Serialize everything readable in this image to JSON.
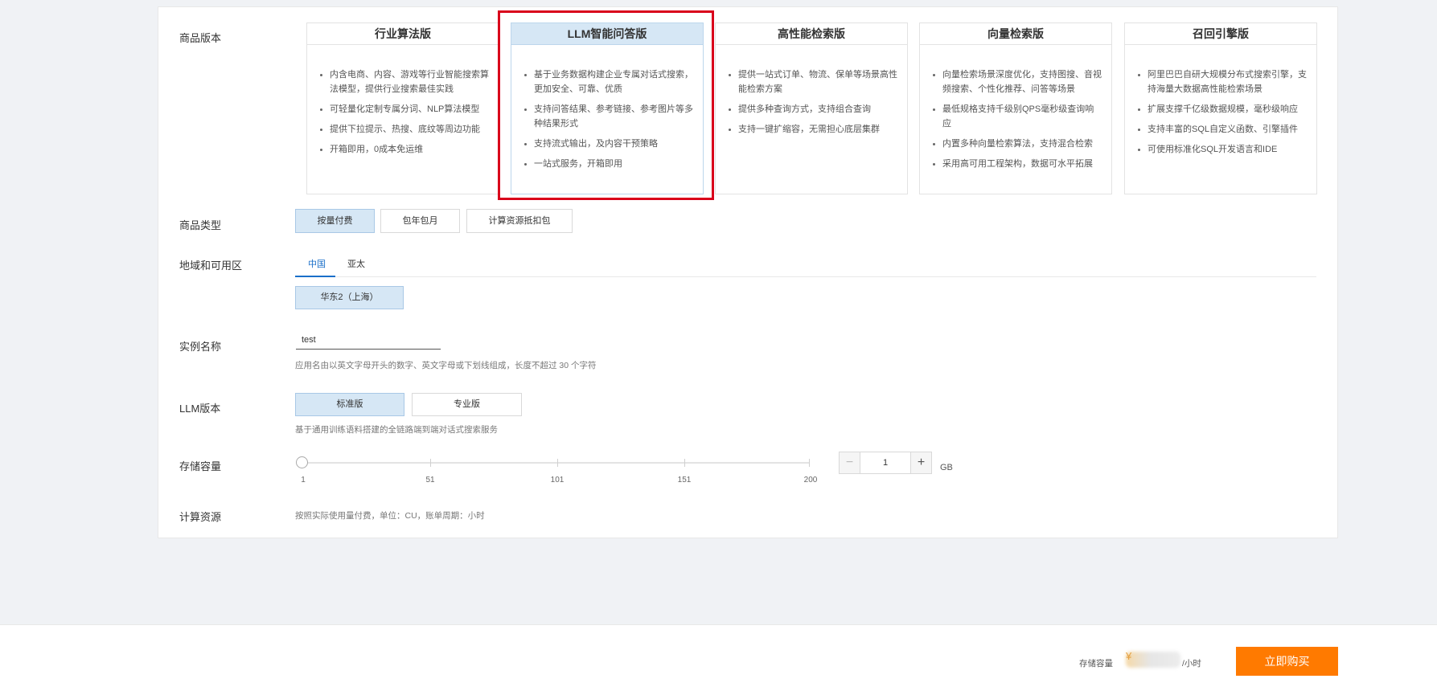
{
  "form": {
    "edition_label": "商品版本",
    "type_label": "商品类型",
    "region_label": "地域和可用区",
    "name_label": "实例名称",
    "llm_label": "LLM版本",
    "storage_label": "存储容量",
    "compute_label": "计算资源"
  },
  "editions": [
    {
      "title": "行业算法版",
      "features": [
        "内含电商、内容、游戏等行业智能搜索算法模型，提供行业搜索最佳实践",
        "可轻量化定制专属分词、NLP算法模型",
        "提供下拉提示、热搜、底纹等周边功能",
        "开箱即用，0成本免运维"
      ]
    },
    {
      "title": "LLM智能问答版",
      "selected": true,
      "features": [
        "基于业务数据构建企业专属对话式搜索，更加安全、可靠、优质",
        "支持问答结果、参考链接、参考图片等多种结果形式",
        "支持流式输出，及内容干预策略",
        "一站式服务，开箱即用"
      ]
    },
    {
      "title": "高性能检索版",
      "features": [
        "提供一站式订单、物流、保单等场景高性能检索方案",
        "提供多种查询方式，支持组合查询",
        "支持一键扩缩容，无需担心底层集群"
      ]
    },
    {
      "title": "向量检索版",
      "features": [
        "向量检索场景深度优化，支持图搜、音视频搜索、个性化推荐、问答等场景",
        "最低规格支持千级别QPS毫秒级查询响应",
        "内置多种向量检索算法，支持混合检索",
        "采用高可用工程架构，数据可水平拓展"
      ]
    },
    {
      "title": "召回引擎版",
      "features": [
        "阿里巴巴自研大规模分布式搜索引擎，支持海量大数据高性能检索场景",
        "扩展支撑千亿级数据规模，毫秒级响应",
        "支持丰富的SQL自定义函数、引擎插件",
        "可使用标准化SQL开发语言和IDE"
      ]
    }
  ],
  "product_types": [
    "按量付费",
    "包年包月",
    "计算资源抵扣包"
  ],
  "region_tabs": [
    "中国",
    "亚太"
  ],
  "zone": "华东2（上海）",
  "instance_name": {
    "value": "test",
    "hint": "应用名由以英文字母开头的数字、英文字母或下划线组成，长度不超过 30 个字符"
  },
  "llm_versions": [
    "标准版",
    "专业版"
  ],
  "llm_hint": "基于通用训练语料搭建的全链路端到端对话式搜索服务",
  "storage": {
    "value": "1",
    "unit": "GB",
    "ticks": [
      "1",
      "51",
      "101",
      "151",
      "200"
    ]
  },
  "compute_hint": "按照实际使用量付费，单位：CU，账单周期：小时",
  "footer": {
    "price_label": "存储容量",
    "currency": "¥",
    "price_unit": "/小时",
    "buy_label": "立即购买"
  },
  "colors": {
    "accent": "#1a6fc9",
    "selected_bg": "#d6e7f5",
    "highlight_border": "#d9001b",
    "buy_button": "#ff7a00"
  }
}
